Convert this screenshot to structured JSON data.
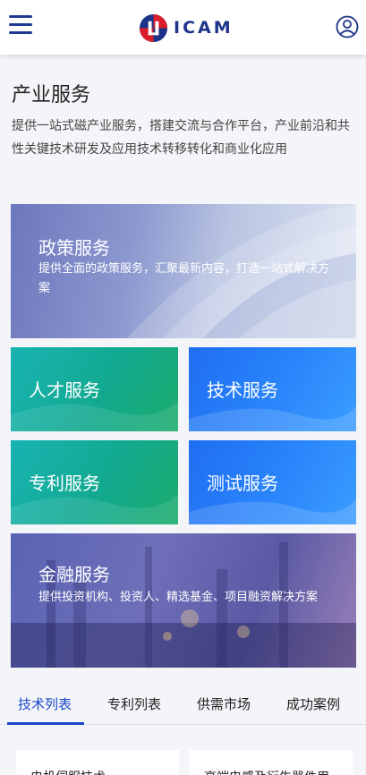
{
  "header": {
    "menu_icon": "hamburger-icon",
    "logo_text": "ICAM",
    "user_icon": "user-circle-icon",
    "brand_blue": "#1d3389",
    "brand_red": "#d91e2a"
  },
  "page": {
    "title": "产业服务",
    "intro": "提供一站式磁产业服务，搭建交流与合作平台，产业前沿和共性关键技术研发及应用技术转移转化和商业化应用"
  },
  "services": {
    "policy": {
      "title": "政策服务",
      "desc": "提供全面的政策服务，汇聚最新内容，打造一站式解决方案"
    },
    "talent": {
      "title": "人才服务"
    },
    "tech": {
      "title": "技术服务"
    },
    "patent": {
      "title": "专利服务"
    },
    "test": {
      "title": "测试服务"
    },
    "finance": {
      "title": "金融服务",
      "desc": "提供投资机构、投资人、精选基金、项目融资解决方案"
    }
  },
  "tabs": [
    {
      "label": "技术列表",
      "active": true
    },
    {
      "label": "专利列表",
      "active": false
    },
    {
      "label": "供需市场",
      "active": false
    },
    {
      "label": "成功案例",
      "active": false
    }
  ],
  "list": [
    {
      "title": "电机伺服技术"
    },
    {
      "title": "高端电感及衍生器件用"
    }
  ],
  "colors": {
    "accent": "#1d48c9",
    "green": "#12a98f",
    "blue": "#2a86fb"
  }
}
